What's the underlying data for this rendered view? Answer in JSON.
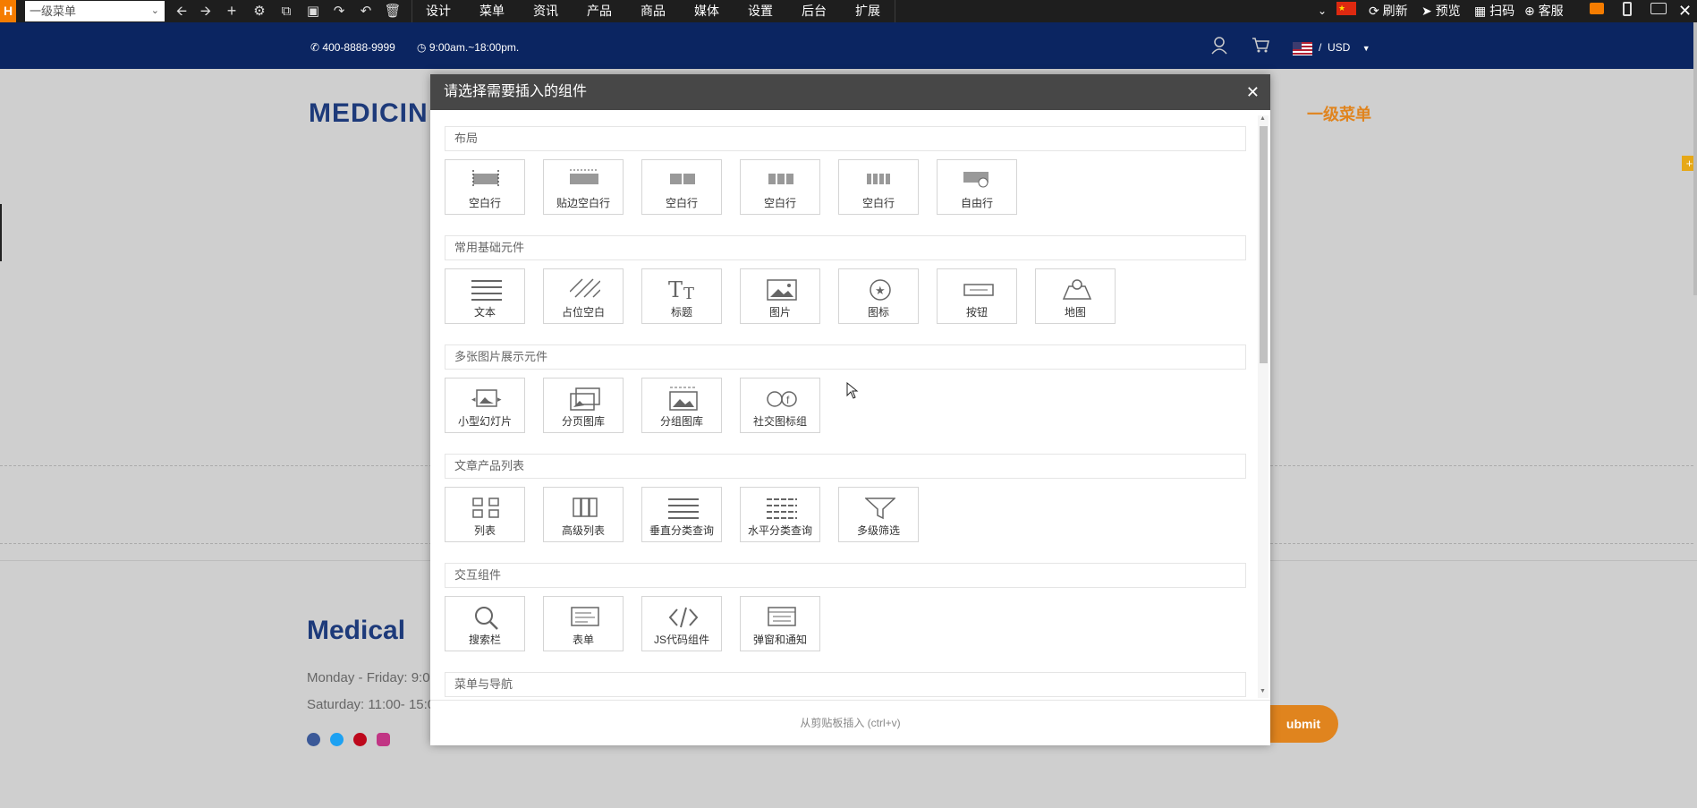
{
  "toolbar": {
    "logo": "H",
    "page_select": "一级菜单",
    "menus": [
      "设计",
      "菜单",
      "资讯",
      "产品",
      "商品",
      "媒体",
      "设置",
      "后台",
      "扩展"
    ],
    "refresh": "刷新",
    "preview": "预览",
    "scan": "扫码",
    "service": "客服"
  },
  "header": {
    "phone": "400-8888-9999",
    "hours": "9:00am.~18:00pm.",
    "currency": "USD",
    "currency_sep": "/",
    "logo_text": "MEDICIN",
    "menu_first": "一级菜单"
  },
  "footer": {
    "title": "Medical",
    "line1": "Monday - Friday: 9:0",
    "line2": "Saturday: 11:00- 15:0",
    "submit": "ubmit"
  },
  "modal": {
    "title": "请选择需要插入的组件",
    "footer_text": "从剪贴板插入 (ctrl+v)",
    "sections": [
      {
        "title": "布局",
        "items": [
          {
            "label": "空白行",
            "icon": "row-1-icon"
          },
          {
            "label": "贴边空白行",
            "icon": "row-full-icon"
          },
          {
            "label": "空白行",
            "icon": "row-2-icon"
          },
          {
            "label": "空白行",
            "icon": "row-3-icon"
          },
          {
            "label": "空白行",
            "icon": "row-4-icon"
          },
          {
            "label": "自由行",
            "icon": "free-row-icon"
          }
        ]
      },
      {
        "title": "常用基础元件",
        "items": [
          {
            "label": "文本",
            "icon": "text-icon"
          },
          {
            "label": "占位空白",
            "icon": "placeholder-icon"
          },
          {
            "label": "标题",
            "icon": "heading-icon"
          },
          {
            "label": "图片",
            "icon": "image-icon"
          },
          {
            "label": "图标",
            "icon": "star-icon"
          },
          {
            "label": "按钮",
            "icon": "button-icon"
          },
          {
            "label": "地图",
            "icon": "map-icon"
          }
        ]
      },
      {
        "title": "多张图片展示元件",
        "items": [
          {
            "label": "小型幻灯片",
            "icon": "slider-icon"
          },
          {
            "label": "分页图库",
            "icon": "gallery-icon"
          },
          {
            "label": "分组图库",
            "icon": "group-gallery-icon"
          },
          {
            "label": "社交图标组",
            "icon": "social-icon"
          }
        ]
      },
      {
        "title": "文章产品列表",
        "items": [
          {
            "label": "列表",
            "icon": "list-icon"
          },
          {
            "label": "高级列表",
            "icon": "advanced-list-icon"
          },
          {
            "label": "垂直分类查询",
            "icon": "vertical-category-icon"
          },
          {
            "label": "水平分类查询",
            "icon": "horizontal-category-icon"
          },
          {
            "label": "多级筛选",
            "icon": "filter-icon"
          }
        ]
      },
      {
        "title": "交互组件",
        "items": [
          {
            "label": "搜索栏",
            "icon": "search-icon"
          },
          {
            "label": "表单",
            "icon": "form-icon"
          },
          {
            "label": "JS代码组件",
            "icon": "code-icon"
          },
          {
            "label": "弹窗和通知",
            "icon": "popup-icon"
          }
        ]
      },
      {
        "title": "菜单与导航",
        "items": []
      }
    ]
  },
  "colors": {
    "brand_navy": "#0b2561",
    "accent_orange": "#e0841e",
    "toolbar_bg": "#1e1e1e"
  }
}
